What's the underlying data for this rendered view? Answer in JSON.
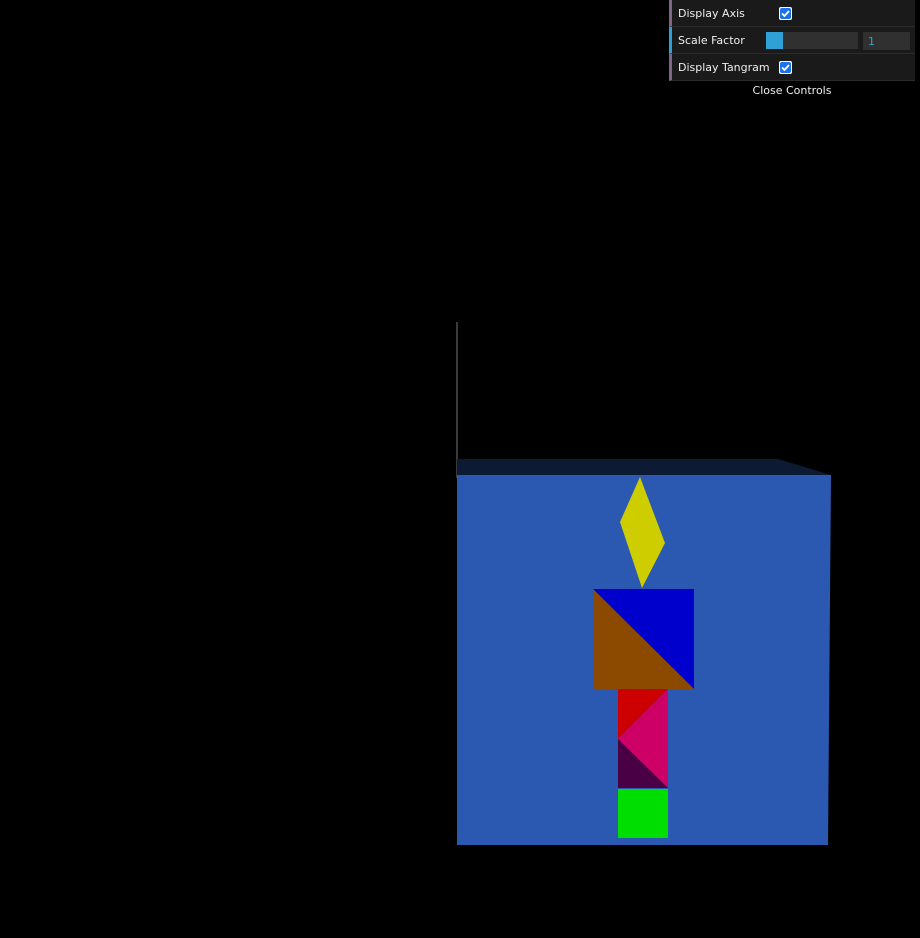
{
  "controls": {
    "display_axis": {
      "label": "Display Axis",
      "checked": true
    },
    "scale_factor": {
      "label": "Scale Factor",
      "value": "1",
      "fill_fraction": 0.18
    },
    "display_tangram": {
      "label": "Display Tangram",
      "checked": true
    },
    "close_label": "Close Controls"
  },
  "scene": {
    "background": "#000000",
    "board_color": "#2b59b1",
    "board_top_color": "#0c1a33",
    "axis_color": "#3a3a3a",
    "pieces": [
      {
        "name": "diamond",
        "color": "#cdcd00"
      },
      {
        "name": "large-triangle-blue",
        "color": "#0000cc"
      },
      {
        "name": "large-triangle-orange",
        "color": "#8b4a00"
      },
      {
        "name": "small-triangle-red",
        "color": "#cc0000"
      },
      {
        "name": "medium-triangle-magenta",
        "color": "#cc0066"
      },
      {
        "name": "small-triangle-purple",
        "color": "#4a0044"
      },
      {
        "name": "square-green",
        "color": "#00dd00"
      }
    ]
  }
}
